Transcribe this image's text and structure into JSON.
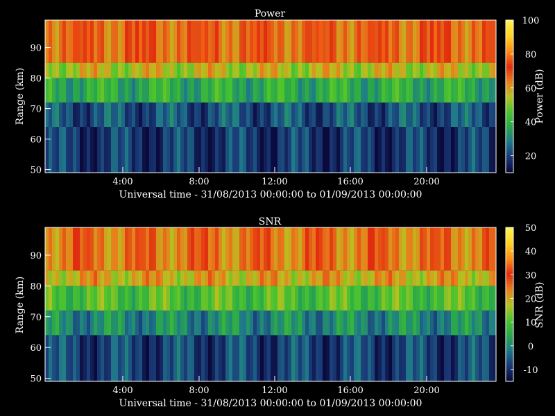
{
  "chart_data": [
    {
      "type": "heatmap",
      "title": "Power",
      "xlabel": "Universal time - 31/08/2013 00:00:00 to 01/09/2013 00:00:00",
      "ylabel": "Range (km)",
      "xlim_hours": [
        0,
        24
      ],
      "ylim": [
        49,
        99
      ],
      "x_ticks": [
        "4:00",
        "8:00",
        "12:00",
        "16:00",
        "20:00"
      ],
      "y_ticks": [
        "50",
        "60",
        "70",
        "80",
        "90"
      ],
      "colorbar": {
        "label": "Power (dB)",
        "range": [
          10,
          100
        ],
        "ticks": [
          "20",
          "40",
          "60",
          "80",
          "100"
        ]
      },
      "cmap": [
        "#0a0a3c",
        "#1a3a78",
        "#1f7a8a",
        "#2aa84a",
        "#4cc42e",
        "#b8c020",
        "#e8801c",
        "#e02c10",
        "#ff8a14",
        "#ffd020",
        "#fff04a"
      ],
      "bands": [
        {
          "range_km": [
            49,
            64
          ],
          "value": 18
        },
        {
          "range_km": [
            64,
            72
          ],
          "value": 22
        },
        {
          "range_km": [
            72,
            80
          ],
          "value": 38
        },
        {
          "range_km": [
            80,
            85
          ],
          "value": 55
        },
        {
          "range_km": [
            85,
            99
          ],
          "value": 68
        }
      ]
    },
    {
      "type": "heatmap",
      "title": "SNR",
      "xlabel": "Universal time - 31/08/2013 00:00:00 to 01/09/2013 00:00:00",
      "ylabel": "Range (km)",
      "xlim_hours": [
        0,
        24
      ],
      "ylim": [
        49,
        99
      ],
      "x_ticks": [
        "4:00",
        "8:00",
        "12:00",
        "16:00",
        "20:00"
      ],
      "y_ticks": [
        "50",
        "60",
        "70",
        "80",
        "90"
      ],
      "colorbar": {
        "label": "SNR (dB)",
        "range": [
          -15,
          50
        ],
        "ticks": [
          "-10",
          "0",
          "10",
          "20",
          "30",
          "40",
          "50"
        ]
      },
      "cmap": [
        "#0a0a3c",
        "#1a3a78",
        "#1f7a8a",
        "#2aa84a",
        "#4cc42e",
        "#b8c020",
        "#e8801c",
        "#e02c10",
        "#ff8a14",
        "#ffd020",
        "#fff04a"
      ],
      "bands": [
        {
          "range_km": [
            49,
            64
          ],
          "value": -8
        },
        {
          "range_km": [
            64,
            72
          ],
          "value": 0
        },
        {
          "range_km": [
            72,
            80
          ],
          "value": 10
        },
        {
          "range_km": [
            80,
            85
          ],
          "value": 20
        },
        {
          "range_km": [
            85,
            99
          ],
          "value": 25
        }
      ]
    }
  ]
}
